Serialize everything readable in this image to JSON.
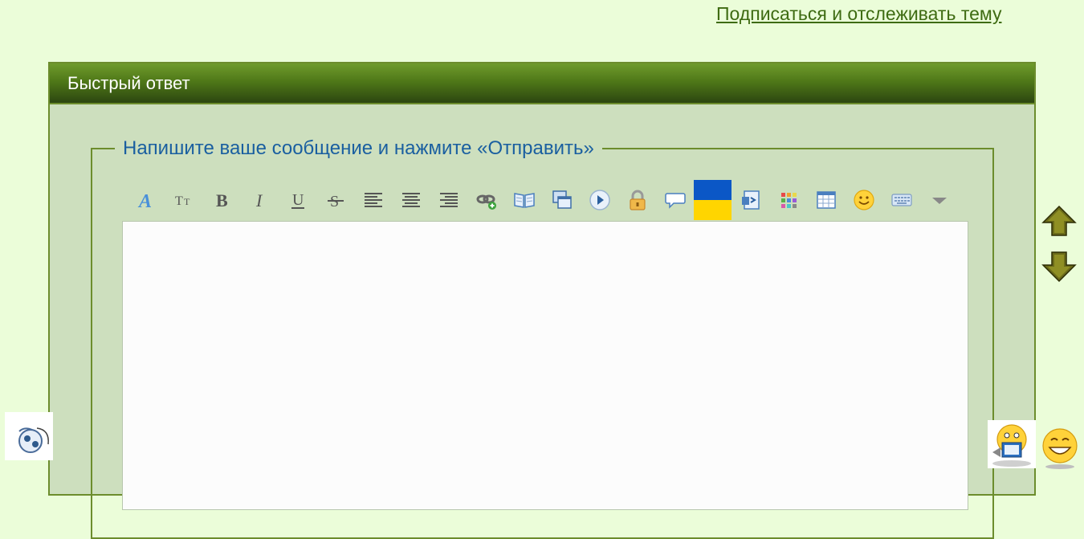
{
  "header": {
    "subscribe_link": "Подписаться и отслеживать тему"
  },
  "quick_reply": {
    "title": "Быстрый ответ",
    "legend": "Напишите ваше сообщение и нажмите «Отправить»",
    "editor_value": ""
  },
  "toolbar": {
    "buttons": [
      {
        "name": "font-icon"
      },
      {
        "name": "font-size-icon"
      },
      {
        "name": "bold-icon"
      },
      {
        "name": "italic-icon"
      },
      {
        "name": "underline-icon"
      },
      {
        "name": "strikethrough-icon"
      },
      {
        "name": "align-left-icon"
      },
      {
        "name": "align-center-icon"
      },
      {
        "name": "align-right-icon"
      },
      {
        "name": "insert-link-icon"
      },
      {
        "name": "book-icon"
      },
      {
        "name": "copy-window-icon"
      },
      {
        "name": "play-video-icon"
      },
      {
        "name": "lock-icon"
      },
      {
        "name": "speech-bubble-icon"
      },
      {
        "name": "ukraine-flag-icon"
      },
      {
        "name": "code-document-icon"
      },
      {
        "name": "color-palette-icon"
      },
      {
        "name": "table-icon"
      },
      {
        "name": "smiley-icon"
      },
      {
        "name": "keyboard-icon"
      },
      {
        "name": "dropdown-arrow-icon"
      }
    ]
  },
  "colors": {
    "page_background": "#ebfdd9",
    "header_green": "#4f7818",
    "panel_background": "#cddfbe",
    "legend_blue": "#1a5fa0",
    "link_green": "#3e6b12"
  }
}
